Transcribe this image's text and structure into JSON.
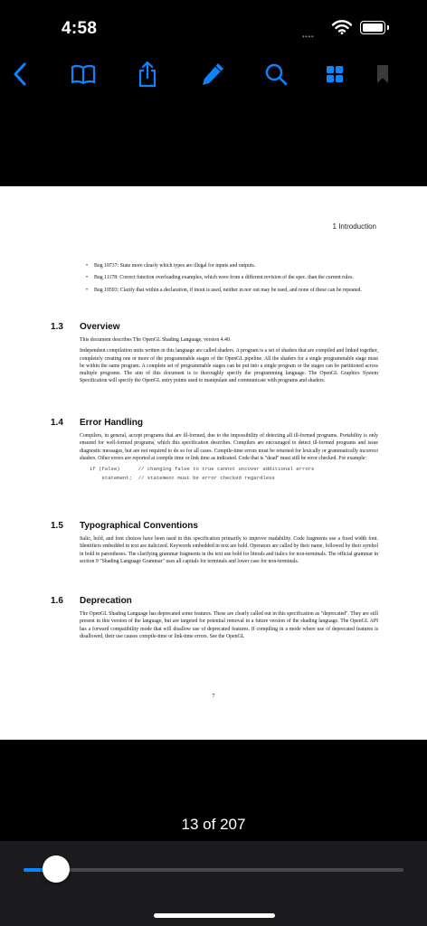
{
  "status_bar": {
    "time": "4:58",
    "signal": "••••"
  },
  "toolbar": {
    "accent": "#0A84FF",
    "icons": [
      "back-chevron-icon",
      "book-icon",
      "share-icon",
      "markup-pencil-icon",
      "search-icon",
      "thumbnail-grid-icon",
      "bookmark-icon"
    ]
  },
  "page": {
    "running_head": "1 Introduction",
    "bullets": [
      "Bug 10737: State more clearly which types are illegal for inputs and outputs.",
      "Bug 11178: Correct function overloading examples, which were from a different revision of the spec. than the current rules.",
      "Bug 10593: Clarify that within a declaration, if inout is used, neither in nor out may be used, and none of these can be repeated."
    ],
    "sections": [
      {
        "number": "1.3",
        "title": "Overview",
        "paragraphs": [
          "This document describes The OpenGL Shading Language, version 4.40.",
          "Independent compilation units written in this language are called shaders. A program is a set of shaders that are compiled and linked together, completely creating one or more of the programmable stages of the OpenGL pipeline. All the shaders for a single programmable stage must be within the same program. A complete set of programmable stages can be put into a single program or the stages can be partitioned across multiple programs. The aim of this document is to thoroughly specify the programming language. The OpenGL Graphics System Specification will specify the OpenGL entry points used to manipulate and communicate with programs and shaders."
        ]
      },
      {
        "number": "1.4",
        "title": "Error Handling",
        "paragraphs": [
          "Compilers, in general, accept programs that are ill-formed, due to the impossibility of detecting all ill-formed programs. Portability is only ensured for well-formed programs, which this specification describes. Compilers are encouraged to detect ill-formed programs and issue diagnostic messages, but are not required to do so for all cases. Compile-time errors must be returned for lexically or grammatically incorrect shaders. Other errors are reported at compile time or link time as indicated. Code that is \"dead\" must still be error checked. For example:"
        ],
        "code": [
          "if (false)      // changing false to true cannot uncover additional errors",
          "    statement;  // statement must be error checked regardless"
        ]
      },
      {
        "number": "1.5",
        "title": "Typographical Conventions",
        "paragraphs": [
          "Italic, bold, and font choices have been used in this specification primarily to improve readability. Code fragments use a fixed width font. Identifiers embedded in text are italicized. Keywords embedded in text are bold. Operators are called by their name, followed by their symbol in bold in parentheses. The clarifying grammar fragments in the text use bold for literals and italics for non-terminals. The official grammar in section 9 \"Shading Language Grammar\" uses all capitals for terminals and lower case for non-terminals."
        ]
      },
      {
        "number": "1.6",
        "title": "Deprecation",
        "paragraphs": [
          "The OpenGL Shading Language has deprecated some features. These are clearly called out in this specification as \"deprecated\". They are still present in this version of the language, but are targeted for potential removal in a future version of the shading language. The OpenGL API has a forward compatibility mode that will disallow use of deprecated features. If compiling in a mode where use of deprecated features is disallowed, their use causes compile-time or link-time errors. See the OpenGL"
        ]
      }
    ],
    "page_number": "7"
  },
  "navigation": {
    "page_indicator": "13 of 207",
    "current_page": 13,
    "total_pages": 207,
    "progress": 0.058
  }
}
